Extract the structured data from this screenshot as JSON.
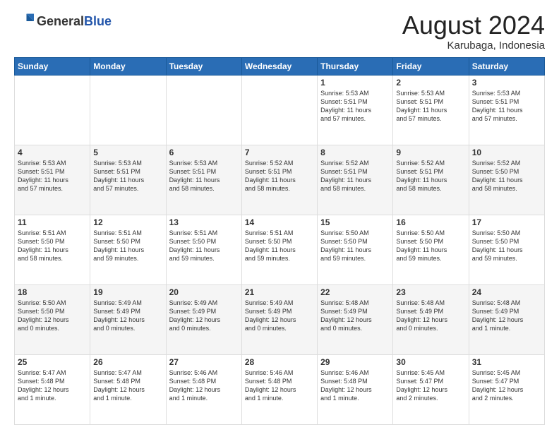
{
  "header": {
    "logo_general": "General",
    "logo_blue": "Blue",
    "month_title": "August 2024",
    "location": "Karubaga, Indonesia"
  },
  "days_of_week": [
    "Sunday",
    "Monday",
    "Tuesday",
    "Wednesday",
    "Thursday",
    "Friday",
    "Saturday"
  ],
  "weeks": [
    [
      {
        "day": "",
        "info": ""
      },
      {
        "day": "",
        "info": ""
      },
      {
        "day": "",
        "info": ""
      },
      {
        "day": "",
        "info": ""
      },
      {
        "day": "1",
        "info": "Sunrise: 5:53 AM\nSunset: 5:51 PM\nDaylight: 11 hours\nand 57 minutes."
      },
      {
        "day": "2",
        "info": "Sunrise: 5:53 AM\nSunset: 5:51 PM\nDaylight: 11 hours\nand 57 minutes."
      },
      {
        "day": "3",
        "info": "Sunrise: 5:53 AM\nSunset: 5:51 PM\nDaylight: 11 hours\nand 57 minutes."
      }
    ],
    [
      {
        "day": "4",
        "info": "Sunrise: 5:53 AM\nSunset: 5:51 PM\nDaylight: 11 hours\nand 57 minutes."
      },
      {
        "day": "5",
        "info": "Sunrise: 5:53 AM\nSunset: 5:51 PM\nDaylight: 11 hours\nand 57 minutes."
      },
      {
        "day": "6",
        "info": "Sunrise: 5:53 AM\nSunset: 5:51 PM\nDaylight: 11 hours\nand 58 minutes."
      },
      {
        "day": "7",
        "info": "Sunrise: 5:52 AM\nSunset: 5:51 PM\nDaylight: 11 hours\nand 58 minutes."
      },
      {
        "day": "8",
        "info": "Sunrise: 5:52 AM\nSunset: 5:51 PM\nDaylight: 11 hours\nand 58 minutes."
      },
      {
        "day": "9",
        "info": "Sunrise: 5:52 AM\nSunset: 5:51 PM\nDaylight: 11 hours\nand 58 minutes."
      },
      {
        "day": "10",
        "info": "Sunrise: 5:52 AM\nSunset: 5:50 PM\nDaylight: 11 hours\nand 58 minutes."
      }
    ],
    [
      {
        "day": "11",
        "info": "Sunrise: 5:51 AM\nSunset: 5:50 PM\nDaylight: 11 hours\nand 58 minutes."
      },
      {
        "day": "12",
        "info": "Sunrise: 5:51 AM\nSunset: 5:50 PM\nDaylight: 11 hours\nand 59 minutes."
      },
      {
        "day": "13",
        "info": "Sunrise: 5:51 AM\nSunset: 5:50 PM\nDaylight: 11 hours\nand 59 minutes."
      },
      {
        "day": "14",
        "info": "Sunrise: 5:51 AM\nSunset: 5:50 PM\nDaylight: 11 hours\nand 59 minutes."
      },
      {
        "day": "15",
        "info": "Sunrise: 5:50 AM\nSunset: 5:50 PM\nDaylight: 11 hours\nand 59 minutes."
      },
      {
        "day": "16",
        "info": "Sunrise: 5:50 AM\nSunset: 5:50 PM\nDaylight: 11 hours\nand 59 minutes."
      },
      {
        "day": "17",
        "info": "Sunrise: 5:50 AM\nSunset: 5:50 PM\nDaylight: 11 hours\nand 59 minutes."
      }
    ],
    [
      {
        "day": "18",
        "info": "Sunrise: 5:50 AM\nSunset: 5:50 PM\nDaylight: 12 hours\nand 0 minutes."
      },
      {
        "day": "19",
        "info": "Sunrise: 5:49 AM\nSunset: 5:49 PM\nDaylight: 12 hours\nand 0 minutes."
      },
      {
        "day": "20",
        "info": "Sunrise: 5:49 AM\nSunset: 5:49 PM\nDaylight: 12 hours\nand 0 minutes."
      },
      {
        "day": "21",
        "info": "Sunrise: 5:49 AM\nSunset: 5:49 PM\nDaylight: 12 hours\nand 0 minutes."
      },
      {
        "day": "22",
        "info": "Sunrise: 5:48 AM\nSunset: 5:49 PM\nDaylight: 12 hours\nand 0 minutes."
      },
      {
        "day": "23",
        "info": "Sunrise: 5:48 AM\nSunset: 5:49 PM\nDaylight: 12 hours\nand 0 minutes."
      },
      {
        "day": "24",
        "info": "Sunrise: 5:48 AM\nSunset: 5:49 PM\nDaylight: 12 hours\nand 1 minute."
      }
    ],
    [
      {
        "day": "25",
        "info": "Sunrise: 5:47 AM\nSunset: 5:48 PM\nDaylight: 12 hours\nand 1 minute."
      },
      {
        "day": "26",
        "info": "Sunrise: 5:47 AM\nSunset: 5:48 PM\nDaylight: 12 hours\nand 1 minute."
      },
      {
        "day": "27",
        "info": "Sunrise: 5:46 AM\nSunset: 5:48 PM\nDaylight: 12 hours\nand 1 minute."
      },
      {
        "day": "28",
        "info": "Sunrise: 5:46 AM\nSunset: 5:48 PM\nDaylight: 12 hours\nand 1 minute."
      },
      {
        "day": "29",
        "info": "Sunrise: 5:46 AM\nSunset: 5:48 PM\nDaylight: 12 hours\nand 1 minute."
      },
      {
        "day": "30",
        "info": "Sunrise: 5:45 AM\nSunset: 5:47 PM\nDaylight: 12 hours\nand 2 minutes."
      },
      {
        "day": "31",
        "info": "Sunrise: 5:45 AM\nSunset: 5:47 PM\nDaylight: 12 hours\nand 2 minutes."
      }
    ]
  ]
}
